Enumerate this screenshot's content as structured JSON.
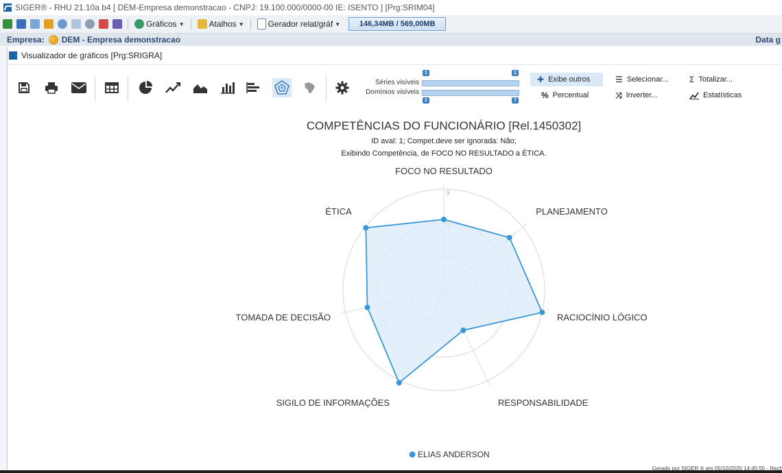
{
  "window": {
    "title": "SIGER® - RHU 21.10a b4 [ DEM-Empresa demonstracao - CNPJ: 19.100.000/0000-00 IE: ISENTO ] [Prg:SRIM04]"
  },
  "app_toolbar": {
    "graficos_label": "Gráficos",
    "atalhos_label": "Atalhos",
    "gerador_label": "Gerador relat/gráf",
    "memory": "146,34MB / 569,00MB"
  },
  "empresa": {
    "label": "Empresa:",
    "name": "DEM - Empresa demonstracao",
    "date_label": "Data g"
  },
  "viewer": {
    "title": "Visualizador de gráficos [Prg:SRIGRA]"
  },
  "chart_toolbar": {
    "series_label": "Séries visíveis",
    "domains_label": "Domínios visíveis",
    "series_min": "1",
    "series_max": "1",
    "domains_min": "1",
    "domains_max": "7",
    "exibe_outros": "Exibe outros",
    "percentual": "Percentual",
    "selecionar": "Selecionar...",
    "inverter": "Inverter...",
    "totalizar": "Totalizar...",
    "estatisticas": "Estatísticas"
  },
  "chart_data": {
    "type": "radar",
    "title": "COMPETÊNCIAS DO FUNCIONÁRIO [Rel.1450302]",
    "subtitle": "ID aval: 1; Compet.deve ser ignorada: Não;",
    "subtitle2": "Exibindo Competência, de FOCO NO RESULTADO a ÉTICA.",
    "categories": [
      "FOCO NO RESULTADO",
      "PLANEJAMENTO",
      "RACIOCÍNIO LÓGICO",
      "RESPONSABILIDADE",
      "SIGILO DE INFORMAÇÕES",
      "TOMADA DE DECISÃO",
      "ÉTICA"
    ],
    "rlim": [
      0,
      9
    ],
    "ticks": [
      3,
      6,
      9
    ],
    "series": [
      {
        "name": "ELIAS ANDERSON",
        "values": [
          6.3,
          7.5,
          9.0,
          4.0,
          9.2,
          7.0,
          8.9
        ]
      }
    ],
    "colors": {
      "series": "#3a97d6",
      "fill": "#dcebf7",
      "grid": "#dddddd"
    }
  },
  "footer": "Gerado por SIGER ® em 05/10/2020 14:45:55 - Rech"
}
